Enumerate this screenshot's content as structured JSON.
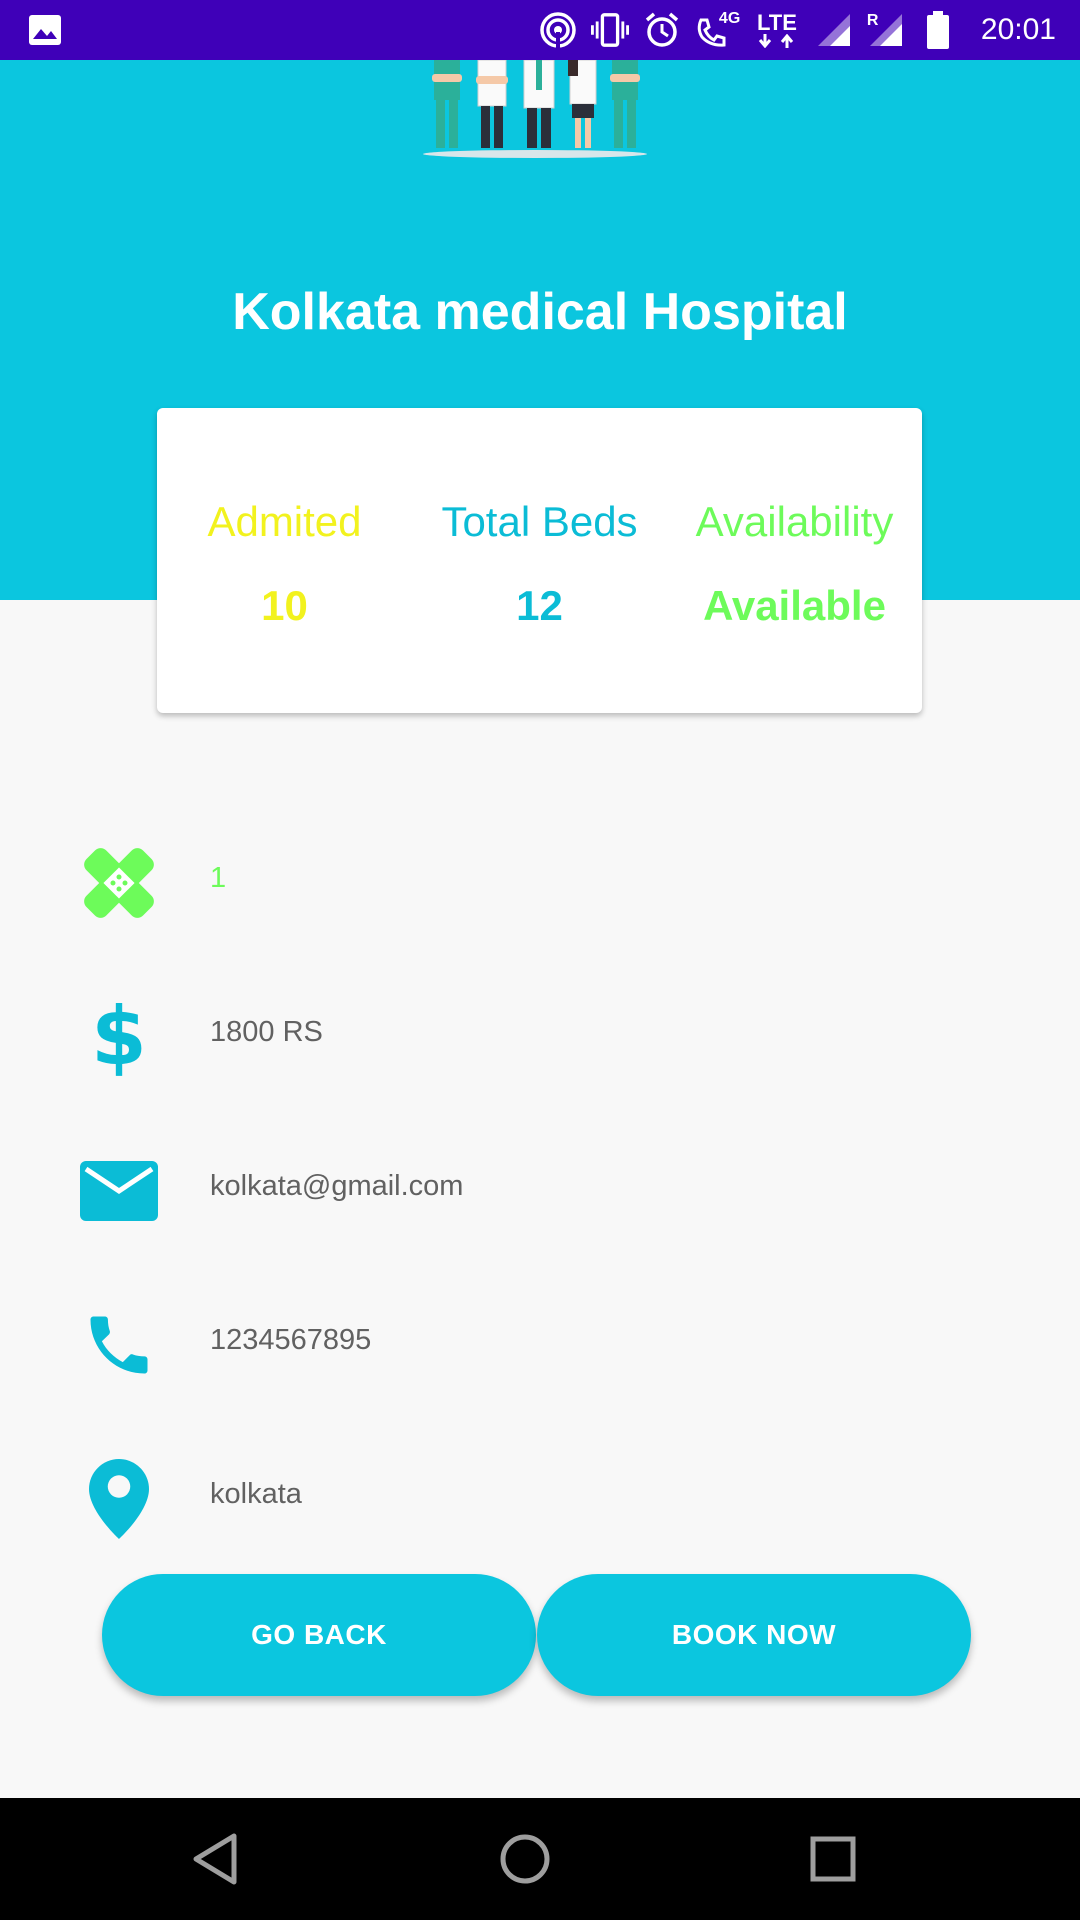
{
  "status_bar": {
    "time": "20:01",
    "icons": [
      "image-icon",
      "hotspot-icon",
      "vibrate-icon",
      "alarm-icon",
      "volte-call-icon",
      "lte-icon",
      "signal-icon",
      "roaming-signal-icon",
      "battery-icon"
    ],
    "network_label_4g": "4G",
    "network_label_lte": "LTE",
    "roaming_label": "R"
  },
  "header": {
    "title": "Kolkata medical Hospital",
    "background_color": "#0bc6df"
  },
  "stats": {
    "admitted": {
      "label": "Admited",
      "value": "10",
      "color": "#f2f21e"
    },
    "total_beds": {
      "label": "Total Beds",
      "value": "12",
      "color": "#0bbcd6"
    },
    "availability": {
      "label": "Availability",
      "value": "Available",
      "color": "#6dfb5a"
    }
  },
  "details": {
    "bandage": "1",
    "price": "1800 RS",
    "email": "kolkata@gmail.com",
    "phone": "1234567895",
    "location": "kolkata"
  },
  "buttons": {
    "go_back": "GO BACK",
    "book_now": "BOOK NOW"
  }
}
